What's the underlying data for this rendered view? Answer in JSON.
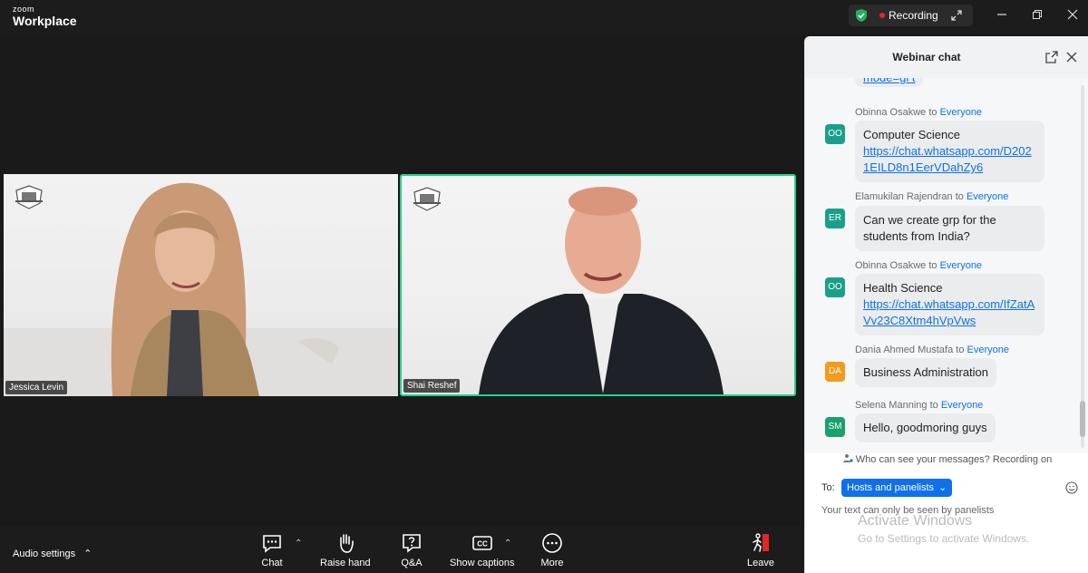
{
  "app": {
    "brand_small": "zoom",
    "brand_big": "Workplace"
  },
  "titlebar": {
    "recording_label": "Recording"
  },
  "participants": [
    {
      "name": "Jessica Levin"
    },
    {
      "name": "Shai Reshef"
    }
  ],
  "toolbar": {
    "audio_settings": "Audio settings",
    "chat": "Chat",
    "raise_hand": "Raise hand",
    "qa": "Q&A",
    "captions": "Show captions",
    "more": "More",
    "leave": "Leave"
  },
  "chat": {
    "title": "Webinar chat",
    "partial_link": "mode=gi t",
    "messages": [
      {
        "sender": "Obinna Osakwe",
        "to": "Everyone",
        "initials": "OO",
        "color": "#1aa08a",
        "text": "Computer Science",
        "link": "https://chat.whatsapp.com/D2021EILD8n1EerVDahZy6"
      },
      {
        "sender": "Elamukilan Rajendran",
        "to": "Everyone",
        "initials": "ER",
        "color": "#1aa08a",
        "text": "Can we create grp for the students from India?",
        "link": ""
      },
      {
        "sender": "Obinna Osakwe",
        "to": "Everyone",
        "initials": "OO",
        "color": "#1aa08a",
        "text": "Health Science",
        "link": "https://chat.whatsapp.com/IfZatAVv23C8Xtm4hVpVws"
      },
      {
        "sender": "Dania Ahmed Mustafa",
        "to": "Everyone",
        "initials": "DA",
        "color": "#f29b1d",
        "text": "Business Administration",
        "link": ""
      },
      {
        "sender": "Selena Manning",
        "to": "Everyone",
        "initials": "SM",
        "color": "#1aa06d",
        "text": "Hello, goodmoring guys",
        "link": ""
      }
    ],
    "to_word": "to",
    "notice": "Who can see your messages? Recording on",
    "to_label": "To:",
    "recipient": "Hosts and panelists",
    "placeholder": "Your text can only be seen by panelists"
  },
  "watermark": {
    "line1": "Activate Windows",
    "line2": "Go to Settings to activate Windows."
  }
}
